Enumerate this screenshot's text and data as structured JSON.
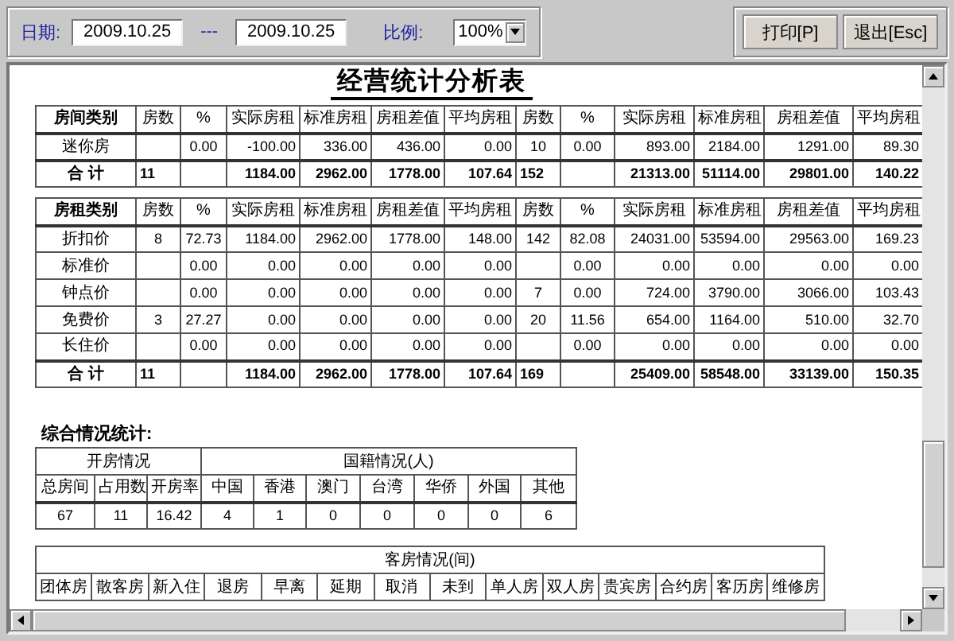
{
  "toolbar": {
    "date_label": "日期:",
    "date_from": "2009.10.25",
    "separator": "---",
    "date_to": "2009.10.25",
    "scale_label": "比例:",
    "scale": "100%",
    "buttons": [
      "打印[P]",
      "退出[Esc]"
    ]
  },
  "report": {
    "title": "经营统计分析表",
    "room_type_table": {
      "columns": [
        "房间类别",
        "房数",
        "%",
        "实际房租",
        "标准房租",
        "房租差值",
        "平均房租",
        "房数",
        "%",
        "实际房租",
        "标准房租",
        "房租差值",
        "平均房租"
      ],
      "rows": [
        {
          "kind": "row",
          "cells": [
            "迷你房",
            "",
            "0.00",
            "-100.00",
            "336.00",
            "436.00",
            "0.00",
            "10",
            "0.00",
            "893.00",
            "2184.00",
            "1291.00",
            "89.30"
          ]
        },
        {
          "kind": "total",
          "cells": [
            "合 计",
            "11",
            "",
            "1184.00",
            "2962.00",
            "1778.00",
            "107.64",
            "152",
            "",
            "21313.00",
            "51114.00",
            "29801.00",
            "140.22"
          ]
        }
      ]
    },
    "rate_type_table": {
      "columns": [
        "房租类别",
        "房数",
        "%",
        "实际房租",
        "标准房租",
        "房租差值",
        "平均房租",
        "房数",
        "%",
        "实际房租",
        "标准房租",
        "房租差值",
        "平均房租"
      ],
      "rows": [
        {
          "kind": "row",
          "cells": [
            "折扣价",
            "8",
            "72.73",
            "1184.00",
            "2962.00",
            "1778.00",
            "148.00",
            "142",
            "82.08",
            "24031.00",
            "53594.00",
            "29563.00",
            "169.23"
          ]
        },
        {
          "kind": "row",
          "cells": [
            "标准价",
            "",
            "0.00",
            "0.00",
            "0.00",
            "0.00",
            "0.00",
            "",
            "0.00",
            "0.00",
            "0.00",
            "0.00",
            "0.00"
          ]
        },
        {
          "kind": "row",
          "cells": [
            "钟点价",
            "",
            "0.00",
            "0.00",
            "0.00",
            "0.00",
            "0.00",
            "7",
            "0.00",
            "724.00",
            "3790.00",
            "3066.00",
            "103.43"
          ]
        },
        {
          "kind": "row",
          "cells": [
            "免费价",
            "3",
            "27.27",
            "0.00",
            "0.00",
            "0.00",
            "0.00",
            "20",
            "11.56",
            "654.00",
            "1164.00",
            "510.00",
            "32.70"
          ]
        },
        {
          "kind": "row",
          "cells": [
            "长住价",
            "",
            "0.00",
            "0.00",
            "0.00",
            "0.00",
            "0.00",
            "",
            "0.00",
            "0.00",
            "0.00",
            "0.00",
            "0.00"
          ]
        },
        {
          "kind": "total",
          "cells": [
            "合 计",
            "11",
            "",
            "1184.00",
            "2962.00",
            "1778.00",
            "107.64",
            "169",
            "",
            "25409.00",
            "58548.00",
            "33139.00",
            "150.35"
          ]
        }
      ]
    },
    "summary_title": "综合情况统计:",
    "summary_table": {
      "group_headers": [
        "开房情况",
        "国籍情况(人)"
      ],
      "columns": [
        "总房间",
        "占用数",
        "开房率",
        "中国",
        "香港",
        "澳门",
        "台湾",
        "华侨",
        "外国",
        "其他"
      ],
      "values": [
        "67",
        "11",
        "16.42",
        "4",
        "1",
        "0",
        "0",
        "0",
        "0",
        "6"
      ]
    },
    "room_status_table": {
      "group_header": "客房情况(间)",
      "columns": [
        "团体房",
        "散客房",
        "新入住",
        "退房",
        "早离",
        "延期",
        "取消",
        "未到",
        "单人房",
        "双人房",
        "贵宾房",
        "合约房",
        "客历房",
        "维修房"
      ]
    }
  }
}
